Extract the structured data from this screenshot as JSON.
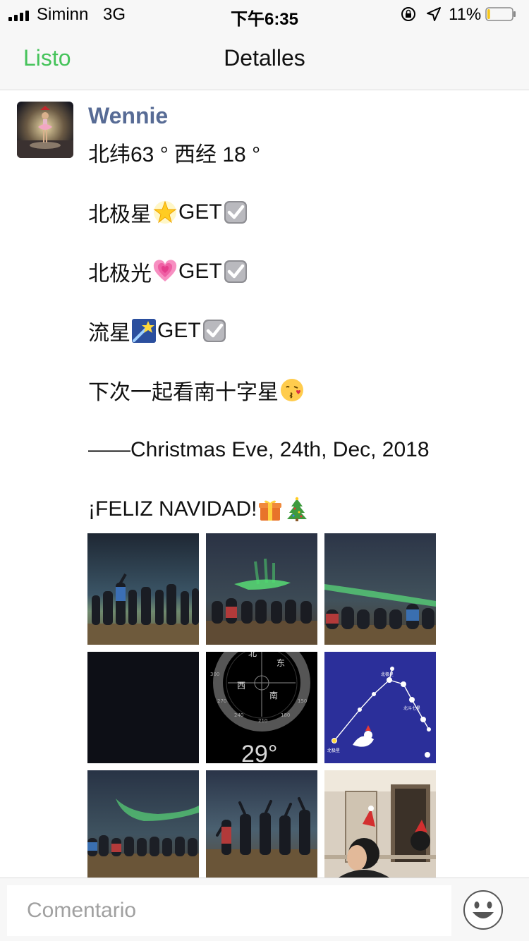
{
  "status_bar": {
    "carrier": "Siminn",
    "network": "3G",
    "time": "下午6:35",
    "battery_percent": "11%",
    "battery_level": 0.11
  },
  "nav": {
    "back_label": "Listo",
    "title": "Detalles"
  },
  "post": {
    "username": "Wennie",
    "lines": [
      "北纬63 ° 西经 18 °",
      "北极星",
      "GET",
      "北极光",
      "GET",
      "流星",
      "GET",
      "下次一起看南十字星",
      "——Christmas Eve, 24th, Dec, 2018",
      "¡FELIZ NAVIDAD!"
    ],
    "photos": [
      {
        "kind": "aurora-crowd"
      },
      {
        "kind": "aurora-crowd"
      },
      {
        "kind": "aurora-crowd"
      },
      {
        "kind": "dark"
      },
      {
        "kind": "compass",
        "labels": [
          "北",
          "东",
          "西",
          "南",
          "300",
          "270",
          "240",
          "210",
          "180",
          "150"
        ],
        "reading": "29°"
      },
      {
        "kind": "constellation",
        "labels": [
          "北极星",
          "北斗七星",
          "北极星"
        ]
      },
      {
        "kind": "aurora-crowd"
      },
      {
        "kind": "jumping-crowd"
      },
      {
        "kind": "selfie"
      }
    ]
  },
  "comment": {
    "placeholder": "Comentario"
  }
}
